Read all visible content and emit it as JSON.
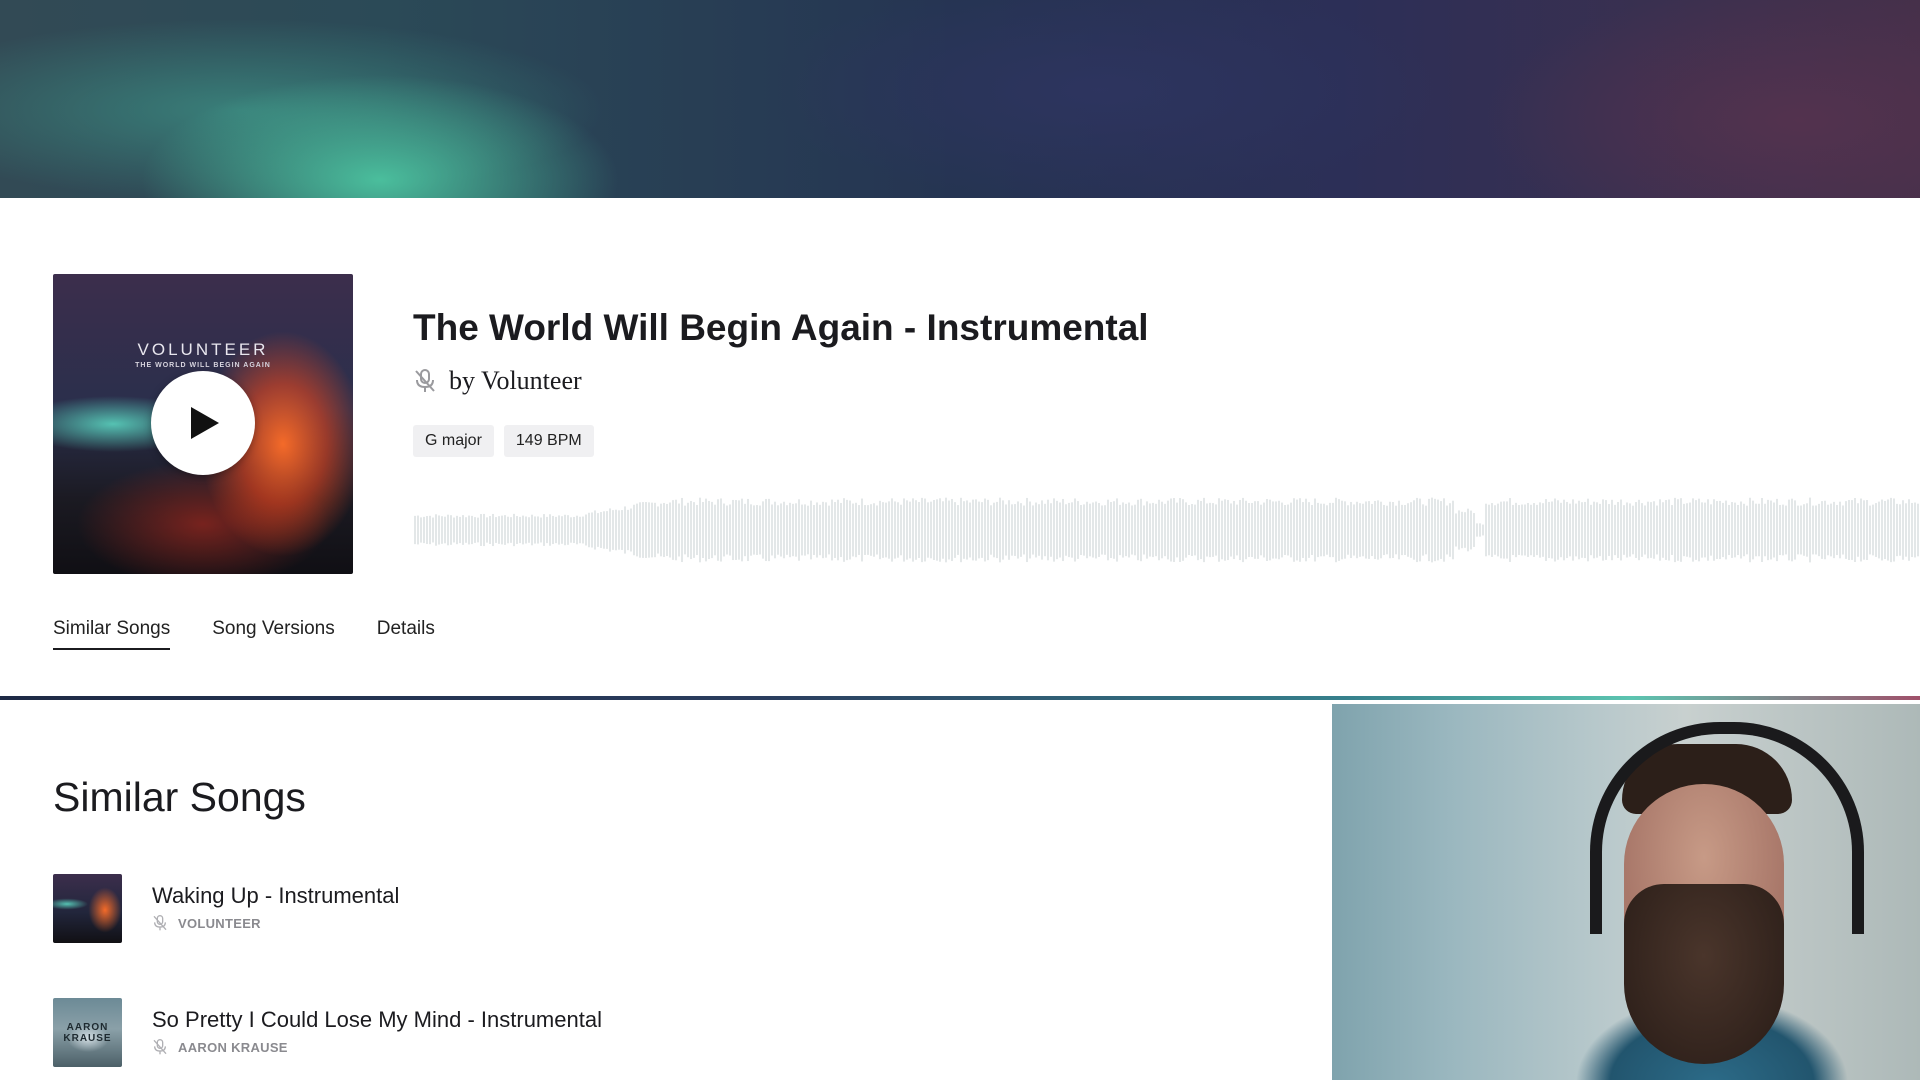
{
  "song": {
    "title": "The World Will Begin Again - Instrumental",
    "artist": "by Volunteer",
    "key": "G major",
    "bpm": "149 BPM",
    "cover_title": "VOLUNTEER",
    "cover_subtitle": "THE WORLD WILL BEGIN AGAIN"
  },
  "tabs": [
    {
      "label": "Similar Songs",
      "active": true
    },
    {
      "label": "Song Versions",
      "active": false
    },
    {
      "label": "Details",
      "active": false
    }
  ],
  "similar": {
    "heading": "Similar Songs",
    "items": [
      {
        "title": "Waking Up - Instrumental",
        "artist": "VOLUNTEER"
      },
      {
        "title": "So Pretty I Could Lose My Mind - Instrumental",
        "artist": "AARON KRAUSE",
        "thumb_text": "AARON KRAUSE"
      }
    ]
  },
  "icons": {
    "play": "play-icon",
    "no_vocals": "mic-off-icon"
  },
  "colors": {
    "waveform": "#e3e7e8",
    "text": "#1b1b1f",
    "muted": "#8a8a8f"
  }
}
